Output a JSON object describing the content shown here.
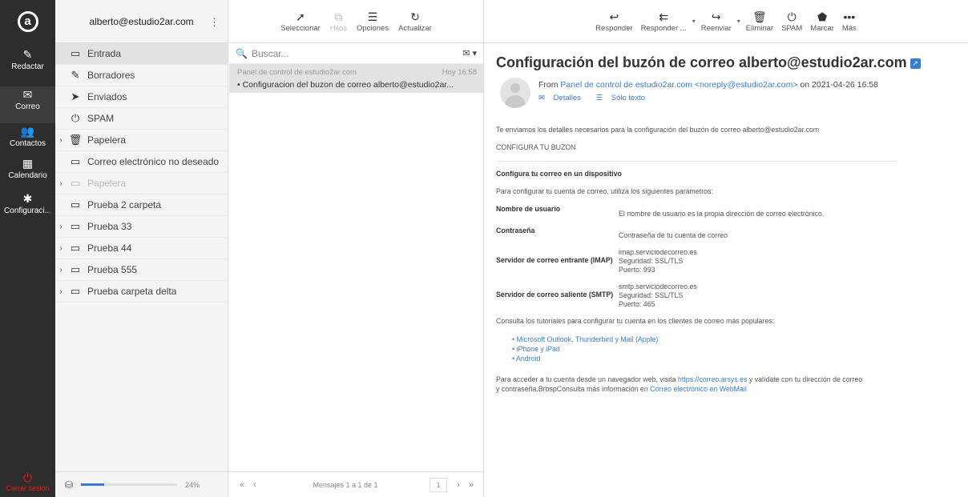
{
  "rail": {
    "logo": "a",
    "items": [
      {
        "label": "Redactar",
        "icon": "compose-icon"
      },
      {
        "label": "Correo",
        "icon": "mail-icon"
      },
      {
        "label": "Contactos",
        "icon": "contacts-icon"
      },
      {
        "label": "Calendario",
        "icon": "calendar-icon"
      },
      {
        "label": "Configuraci...",
        "icon": "gear-icon"
      }
    ],
    "logout": "Cerrar sesión"
  },
  "folders": {
    "account": "alberto@estudio2ar.com",
    "items": [
      {
        "label": "Entrada",
        "expand": "",
        "dim": false,
        "active": true
      },
      {
        "label": "Borradores",
        "expand": "",
        "dim": false
      },
      {
        "label": "Enviados",
        "expand": "",
        "dim": false
      },
      {
        "label": "SPAM",
        "expand": "",
        "dim": false
      },
      {
        "label": "Papelera",
        "expand": "›",
        "dim": false
      },
      {
        "label": "Correo electrónico no deseado",
        "expand": "",
        "dim": false
      },
      {
        "label": "Papelera",
        "expand": "›",
        "dim": true
      },
      {
        "label": "Prueba 2 carpeta",
        "expand": "",
        "dim": false
      },
      {
        "label": "Prueba 33",
        "expand": "›",
        "dim": false
      },
      {
        "label": "Prueba 44",
        "expand": "›",
        "dim": false
      },
      {
        "label": "Prueba 555",
        "expand": "›",
        "dim": false
      },
      {
        "label": "Prueba carpeta delta",
        "expand": "›",
        "dim": false
      }
    ],
    "quota_percent": 24,
    "quota_label": "24%"
  },
  "list_toolbar": {
    "select": "Seleccionar",
    "threads": "Hilos",
    "options": "Opciones",
    "refresh": "Actualizar"
  },
  "search": {
    "placeholder": "Buscar..."
  },
  "messages": [
    {
      "from": "Panel de control de estudio2ar.com",
      "date": "Hoy 16:58",
      "subject": "• Configuracion del buzon de correo alberto@estudio2ar..."
    }
  ],
  "pager": {
    "first": "«",
    "prev": "‹",
    "count": "Mensajes 1 a 1 de 1",
    "page": "1",
    "next": "›",
    "last": "»"
  },
  "reader_toolbar": {
    "reply": "Responder",
    "reply_all": "Responder ...",
    "forward": "Reenviar",
    "delete": "Eliminar",
    "spam": "SPAM",
    "mark": "Marcar",
    "more": "Más"
  },
  "email": {
    "subject": "Configuración del buzón de correo alberto@estudio2ar.com",
    "from_prefix": "From",
    "from_name": "Panel de control de estudio2ar.com <noreply@estudio2ar.com>",
    "from_suffix": "on 2021-04-26 16:58",
    "details": "Detalles",
    "plain": "Sólo texto",
    "intro": "Te enviamos los detalles necesarios para la configuración del buzón de correo alberto@estudio2ar.com",
    "section": "CONFIGURA TU BUZON",
    "cfg_title": "Configura tu correo en un dispositivo",
    "cfg_desc": "Para configurar tu cuenta de correo, utiliza los siguientes parámetros:",
    "params": [
      {
        "k": "Nombre de usuario",
        "v": [
          "El nombre de usuario es la propia dirección de correo electrónico."
        ]
      },
      {
        "k": "Contraseña",
        "v": [
          "Contraseña de tu cuenta de correo"
        ]
      },
      {
        "k": "Servidor de correo entrante (IMAP)",
        "v": [
          "imap.serviciodecorreo.es",
          "Seguridad: SSL/TLS",
          "Puerto: 993"
        ]
      },
      {
        "k": "Servidor de correo saliente (SMTP)",
        "v": [
          "smtp.serviciodecorreo.es",
          "Seguridad: SSL/TLS",
          "Puerto: 465"
        ]
      }
    ],
    "tutorials": "Consulta los tutoriales para configurar tu cuenta en los clientes de correo más populares:",
    "tutorial_links": [
      "• Microsoft Outlook, Thunderbird y Mail (Apple)",
      "• iPhone y iPad",
      "• Android"
    ],
    "webmail_a": "Para acceder a tu cuenta desde un navegador web, visita",
    "webmail_link": "https://correo.arsys.es",
    "webmail_b": "y valídate con tu dirección de correo",
    "webmail_c": "y contraseña.BrbspConsulta más información en",
    "webmail_link2": "Correo electrónico en WebMail"
  }
}
